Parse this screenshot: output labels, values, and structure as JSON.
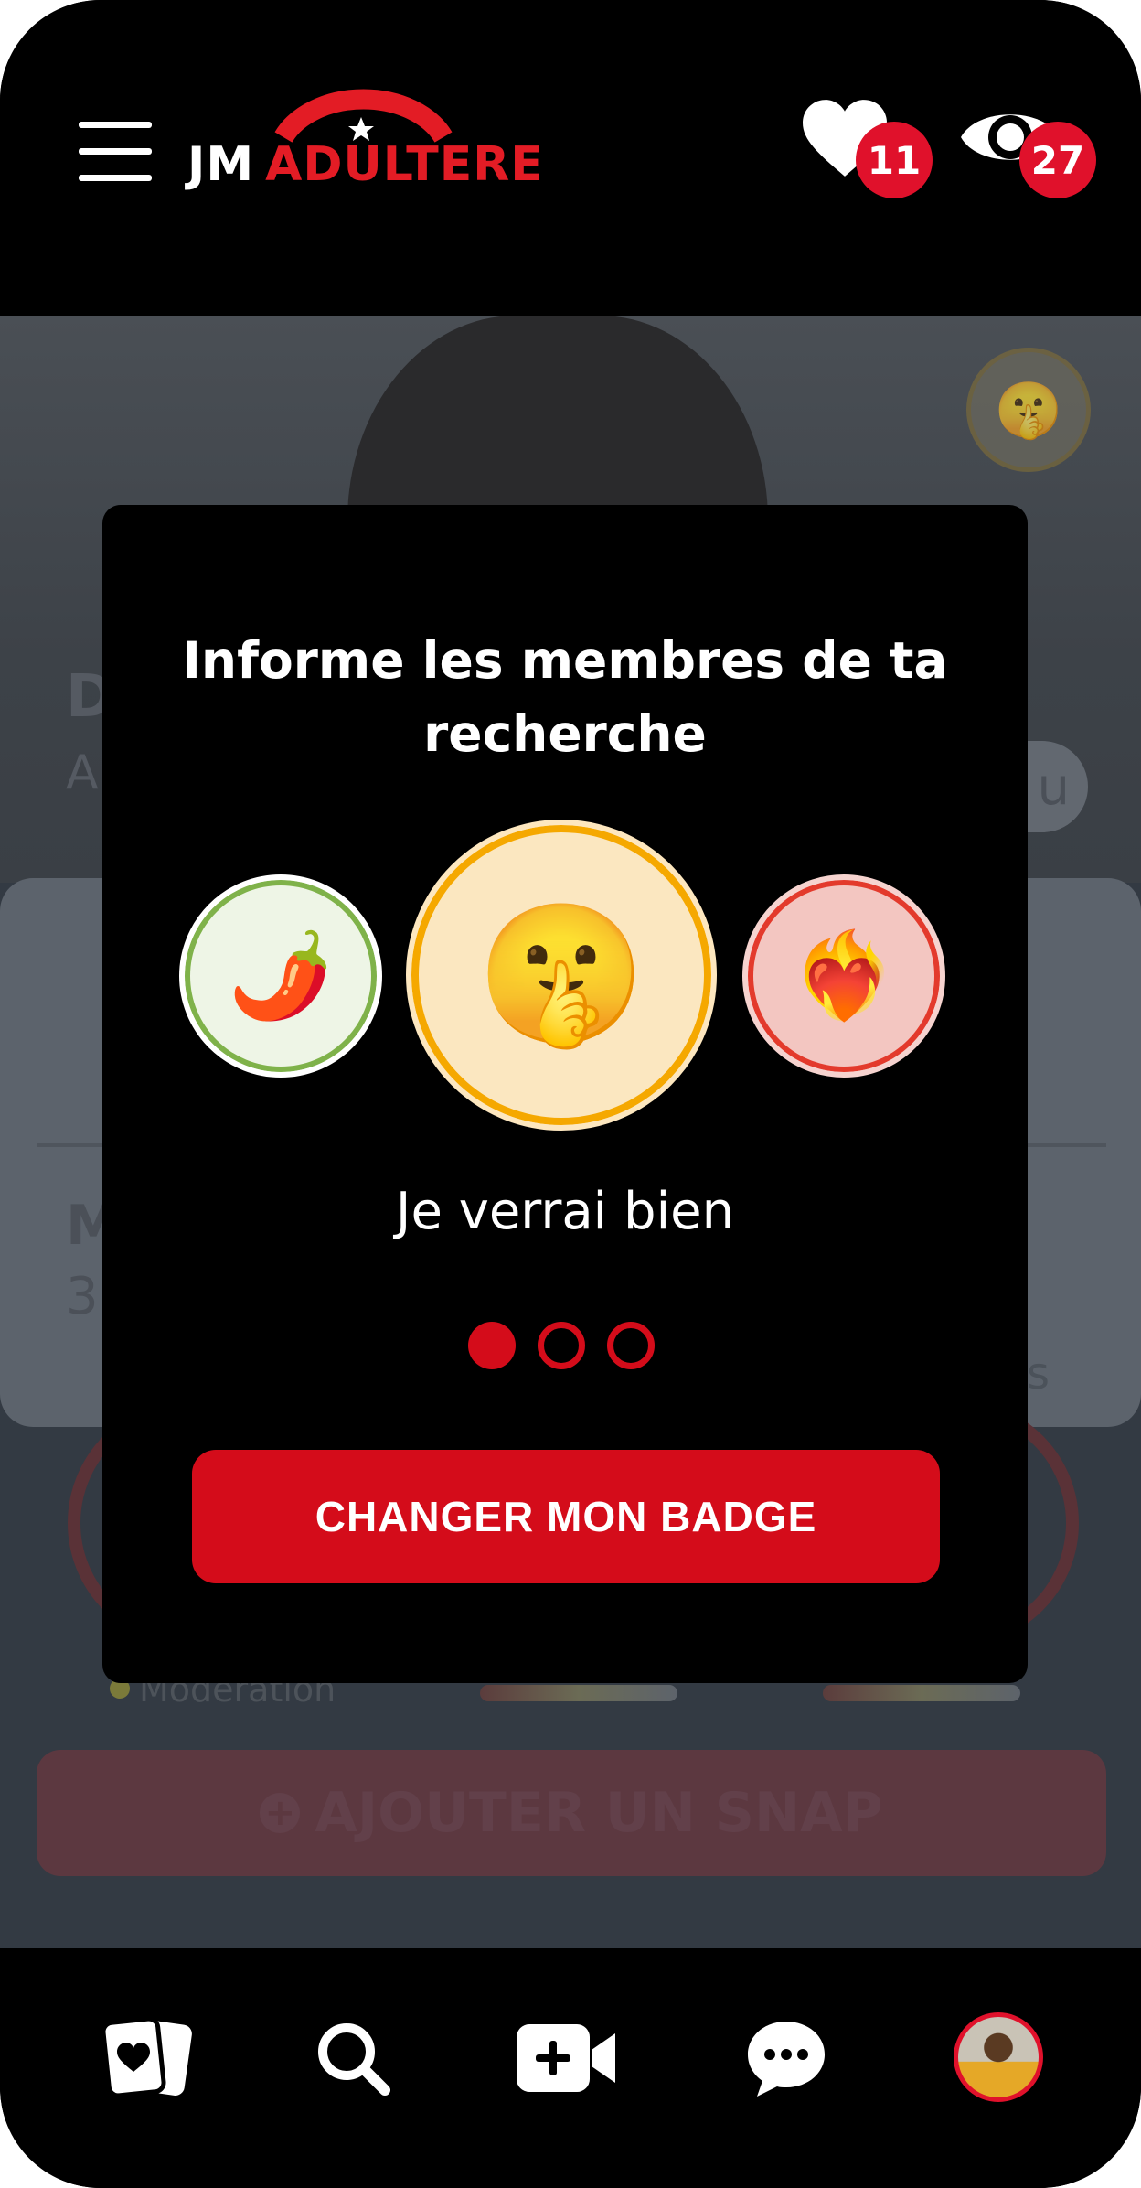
{
  "header": {
    "logo_jm": "JM",
    "logo_adultere": "ADULTERE",
    "likes_count": "11",
    "views_count": "27"
  },
  "background": {
    "name_initial": "D",
    "sub_initial": "A",
    "pill_text": "u",
    "stats_label": "s",
    "section_initial": "M",
    "section_sub": "3",
    "moderation": "Modération",
    "snap_button": "AJOUTER UN SNAP"
  },
  "modal": {
    "title": "Informe les membres de ta recherche",
    "options": [
      {
        "name": "chili",
        "emoji": "🌶️",
        "color": "#7fb24a"
      },
      {
        "name": "shush",
        "emoji": "🤫",
        "color": "#f5a800",
        "selected": true
      },
      {
        "name": "heart-on-fire",
        "emoji": "❤️‍🔥",
        "color": "#e33a2c"
      }
    ],
    "caption": "Je verrai bien",
    "page_dots": {
      "current": 1,
      "total": 3
    },
    "button": "CHANGER MON BADGE"
  },
  "bottom_nav": {
    "items": [
      "cards-icon",
      "search-icon",
      "video-add-icon",
      "chat-icon",
      "profile-avatar"
    ]
  },
  "colors": {
    "accent": "#d40c1a",
    "header_bg": "#000000"
  }
}
